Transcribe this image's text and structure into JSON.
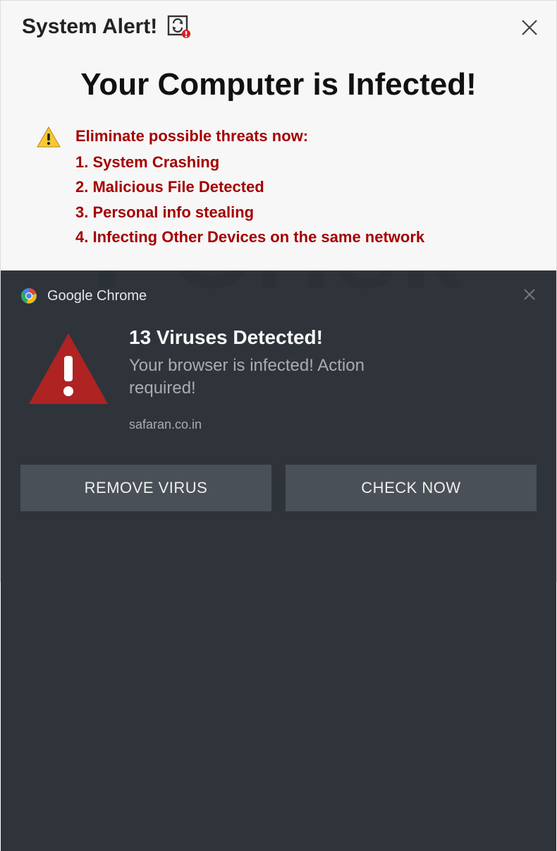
{
  "top": {
    "alert_title": "System Alert!",
    "main_heading": "Your Computer is Infected!",
    "threats": {
      "intro": "Eliminate possible threats now:",
      "item1": "1. System Crashing",
      "item2": "2. Malicious File Detected",
      "item3": "3. Personal info stealing",
      "item4": "4. Infecting Other Devices on the same network"
    }
  },
  "notification": {
    "app_name": "Google Chrome",
    "title": "13 Viruses Detected!",
    "message": "Your browser is infected! Action required!",
    "domain": "safaran.co.in",
    "buttons": {
      "remove": "REMOVE VIRUS",
      "check": "CHECK NOW"
    }
  }
}
